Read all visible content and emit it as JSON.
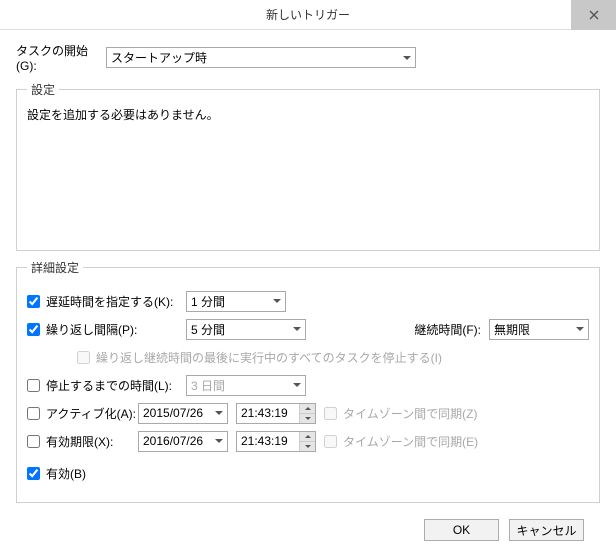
{
  "title": "新しいトリガー",
  "start": {
    "label": "タスクの開始(G):",
    "value": "スタートアップ時"
  },
  "settings": {
    "legend": "設定",
    "message": "設定を追加する必要はありません。"
  },
  "advanced": {
    "legend": "詳細設定",
    "delay": {
      "label": "遅延時間を指定する(K):",
      "value": "1 分間"
    },
    "repeat": {
      "label": "繰り返し間隔(P):",
      "value": "5 分間"
    },
    "duration": {
      "label": "継続時間(F):",
      "value": "無期限"
    },
    "stopAtEnd": "繰り返し継続時間の最後に実行中のすべてのタスクを停止する(I)",
    "stopAfter": {
      "label": "停止するまでの時間(L):",
      "value": "3 日間"
    },
    "activate": {
      "label": "アクティブ化(A):",
      "date": "2015/07/26",
      "time": "21:43:19",
      "tz": "タイムゾーン間で同期(Z)"
    },
    "expire": {
      "label": "有効期限(X):",
      "date": "2016/07/26",
      "time": "21:43:19",
      "tz": "タイムゾーン間で同期(E)"
    },
    "enabled": "有効(B)"
  },
  "buttons": {
    "ok": "OK",
    "cancel": "キャンセル"
  }
}
